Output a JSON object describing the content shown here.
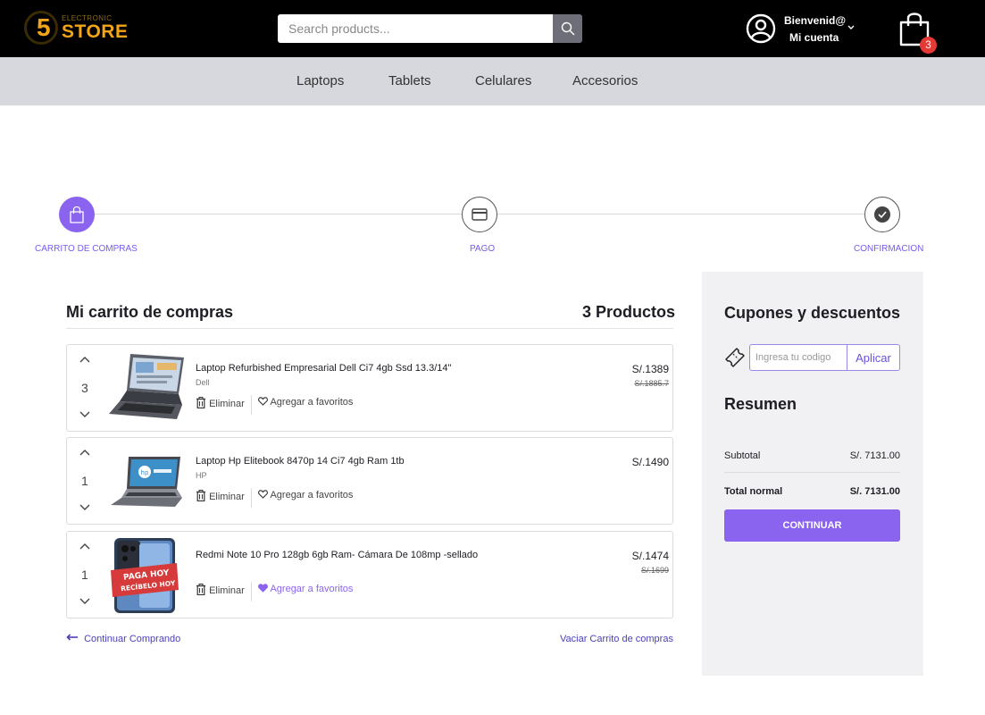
{
  "header": {
    "logo": {
      "top_text": "ELECTRONIC",
      "numeral": "5",
      "brand": "STORE"
    },
    "search": {
      "placeholder": "Search products...",
      "value": ""
    },
    "account": {
      "greeting": "Bienvenid@",
      "label": "Mi cuenta"
    },
    "cart_badge": "3"
  },
  "nav": {
    "items": [
      {
        "label": "Laptops"
      },
      {
        "label": "Tablets"
      },
      {
        "label": "Celulares"
      },
      {
        "label": "Accesorios"
      }
    ]
  },
  "stepper": {
    "steps": [
      {
        "label": "CARRITO DE COMPRAS",
        "icon": "bag-icon"
      },
      {
        "label": "PAGO",
        "icon": "credit-card-icon"
      },
      {
        "label": "CONFIRMACION",
        "icon": "check-circle-icon"
      }
    ]
  },
  "cart": {
    "title": "Mi carrito de compras",
    "count": "3 Productos",
    "items": [
      {
        "name": "Laptop Refurbished Empresarial Dell Ci7 4gb Ssd 13.3/14\"",
        "brand": "Dell",
        "qty": "3",
        "price": "S/.1389",
        "old_price": "S/.1885.7",
        "delete": "Eliminar",
        "favorite": "Agregar a favoritos",
        "favorited": false
      },
      {
        "name": "Laptop Hp Elitebook 8470p 14 Ci7 4gb Ram 1tb",
        "brand": "HP",
        "qty": "1",
        "price": "S/.1490",
        "old_price": "",
        "delete": "Eliminar",
        "favorite": "Agregar a favoritos",
        "favorited": false
      },
      {
        "name": "Redmi Note 10 Pro 128gb 6gb Ram- Cámara De 108mp -sellado",
        "brand": "",
        "qty": "1",
        "price": "S/.1474",
        "old_price": "S/.1699",
        "delete": "Eliminar",
        "favorite": "Agregar a favoritos",
        "favorited": true,
        "promo_text": [
          "PAGA HOY",
          "RECÍBELO HOY"
        ]
      }
    ],
    "continue_shopping": "Continuar Comprando",
    "empty_cart": "Vaciar Carrito de compras"
  },
  "summary": {
    "coupons_title": "Cupones y descuentos",
    "coupon_placeholder": "Ingresa tu codigo",
    "apply_label": "Aplicar",
    "title": "Resumen",
    "subtotal_label": "Subtotal",
    "subtotal_value": "S/. 7131.00",
    "total_label": "Total normal",
    "total_value": "S/. 7131.00",
    "continue_label": "CONTINUAR"
  },
  "colors": {
    "accent": "#8a63ee",
    "header_bg": "#000000",
    "nav_bg": "#d7d8dd",
    "badge": "#e53935",
    "logo": "#f2a516"
  }
}
